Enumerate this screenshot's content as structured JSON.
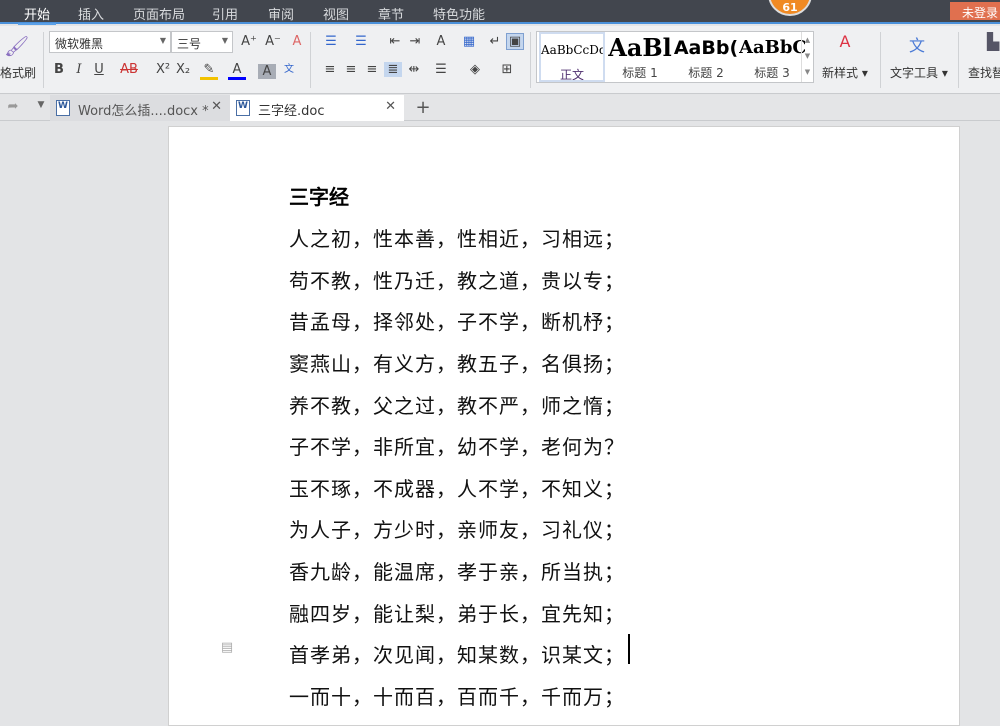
{
  "menu": {
    "tabs": [
      "开始",
      "插入",
      "页面布局",
      "引用",
      "审阅",
      "视图",
      "章节",
      "特色功能"
    ],
    "badge": "61",
    "login": "未登录"
  },
  "ribbon": {
    "format_painter": "格式刷",
    "font": "微软雅黑",
    "size": "三号",
    "styles": [
      {
        "sample": "AaBbCcDd",
        "label": "正文"
      },
      {
        "sample": "AaBl",
        "label": "标题 1"
      },
      {
        "sample": "AaBb(",
        "label": "标题 2"
      },
      {
        "sample": "AaBbC",
        "label": "标题 3"
      }
    ],
    "new_style": "新样式",
    "text_tools": "文字工具",
    "find_replace": "查找替"
  },
  "tabs": [
    {
      "label": "Word怎么插....docx *"
    },
    {
      "label": "三字经.doc"
    }
  ],
  "document": {
    "title": "三字经",
    "lines": [
      "人之初，性本善，性相近，习相远；",
      "苟不教，性乃迁，教之道，贵以专；",
      "昔孟母，择邻处，子不学，断机杼；",
      "窦燕山，有义方，教五子，名俱扬；",
      "养不教，父之过，教不严，师之惰；",
      "子不学，非所宜，幼不学，老何为？",
      "玉不琢，不成器，人不学，不知义；",
      "为人子，方少时，亲师友，习礼仪；",
      "香九龄，能温席，孝于亲，所当执；",
      "融四岁，能让梨，弟于长，宜先知；",
      "首孝弟，次见闻，知某数，识某文；",
      "一而十，十而百，百而千，千而万；"
    ]
  }
}
